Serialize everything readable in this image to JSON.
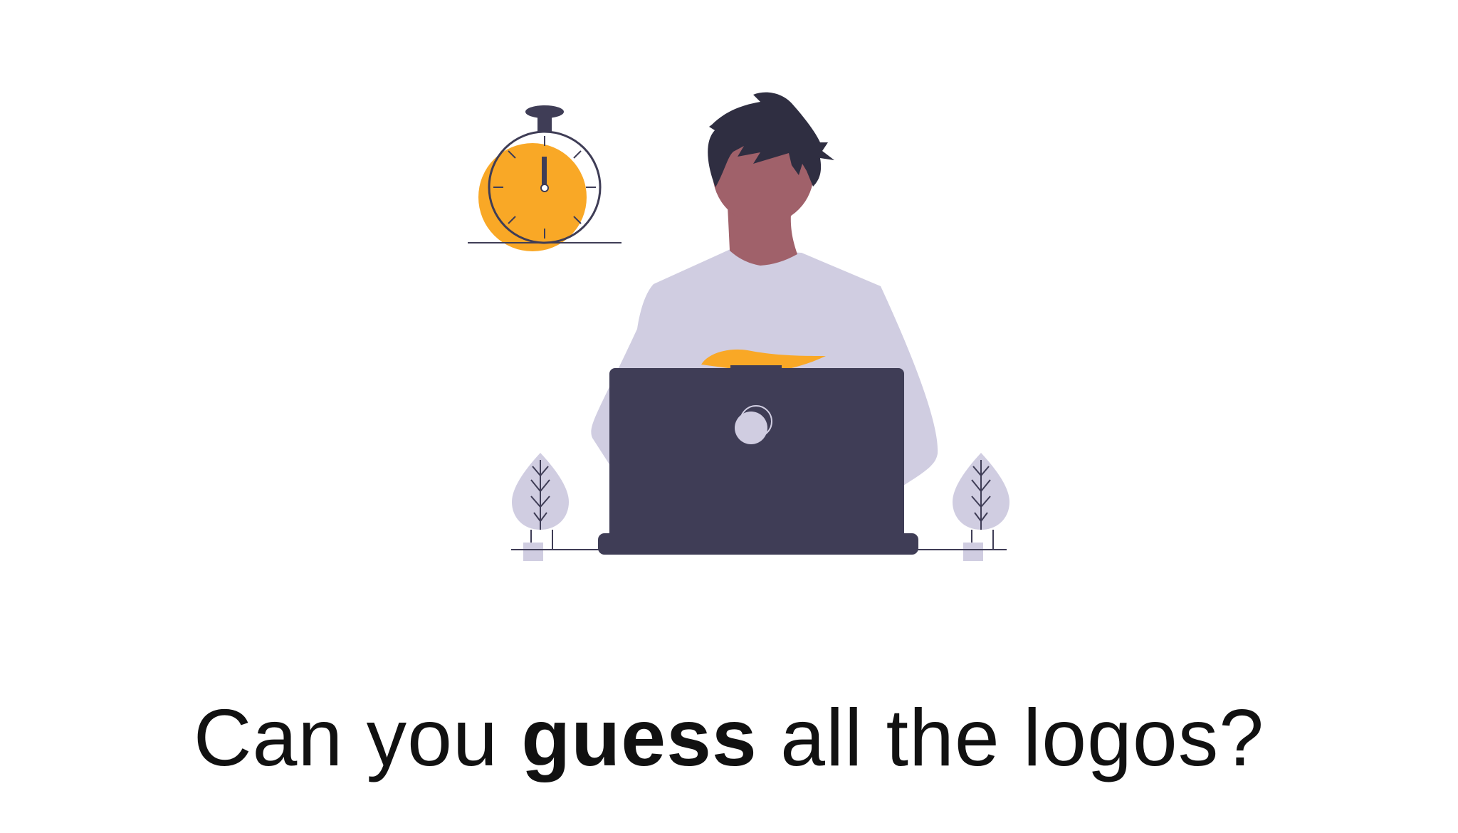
{
  "headline": {
    "before": "Can you ",
    "emphasis": "guess",
    "after": " all the logos?"
  },
  "colors": {
    "background": "#ffffff",
    "accent_orange": "#f9a826",
    "dark_navy": "#3f3d56",
    "lavender": "#d0cde1",
    "skin": "#a0616a",
    "hair": "#2f2e41",
    "text": "#111111"
  },
  "illustration": {
    "elements": [
      "stopwatch-icon",
      "person",
      "laptop",
      "plant-left",
      "plant-right"
    ]
  }
}
